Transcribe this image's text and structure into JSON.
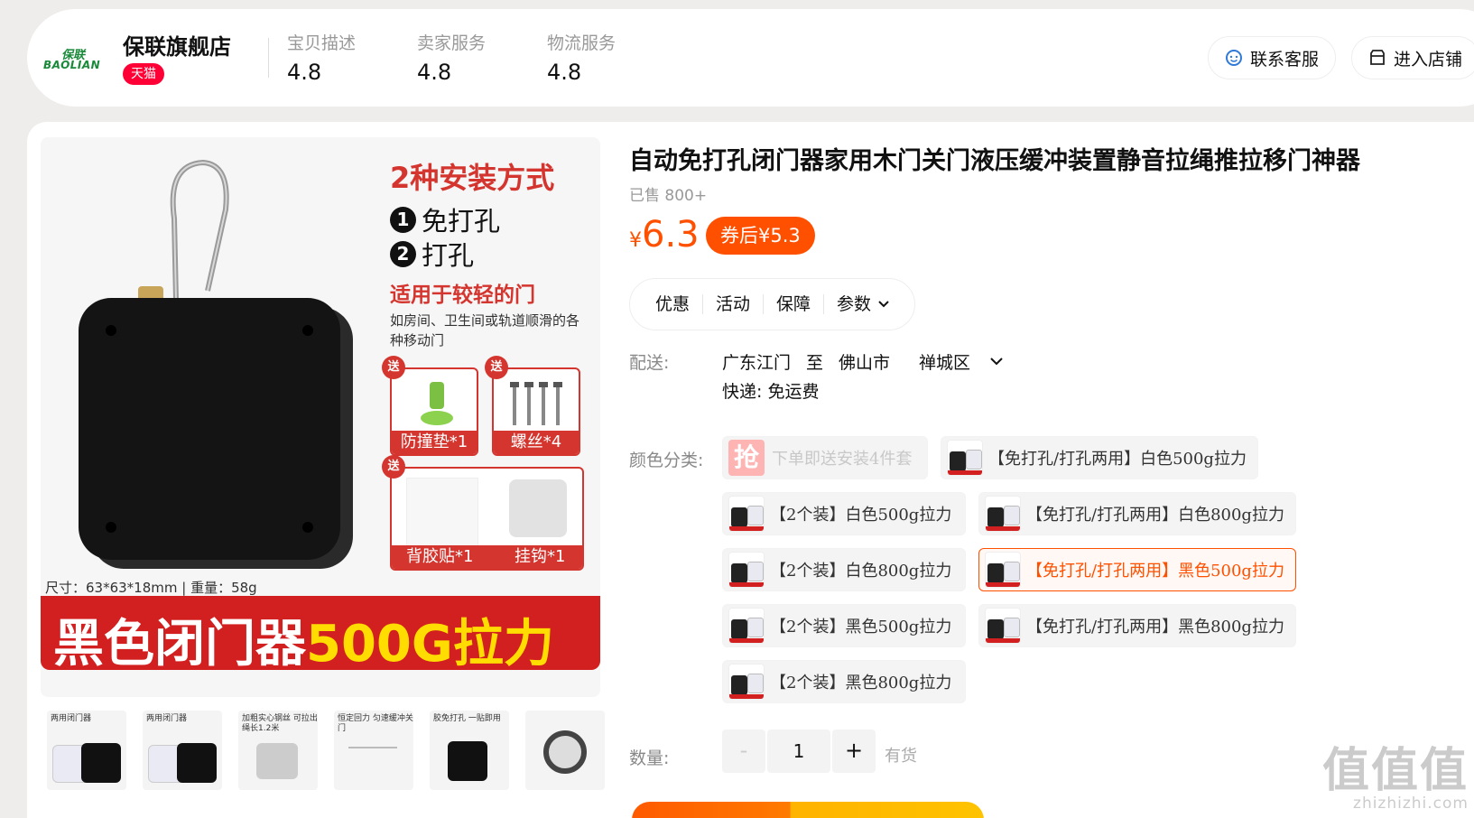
{
  "store": {
    "logo_cn": "保联",
    "logo_en": "BAOLIAN",
    "name": "保联旗舰店",
    "badge": "天猫",
    "ratings": [
      {
        "label": "宝贝描述",
        "value": "4.8"
      },
      {
        "label": "卖家服务",
        "value": "4.8"
      },
      {
        "label": "物流服务",
        "value": "4.8"
      }
    ],
    "contact_label": "联系客服",
    "enter_label": "进入店铺"
  },
  "image": {
    "install_title": "2种安装方式",
    "install_items": [
      {
        "num": "1",
        "text": "免打孔"
      },
      {
        "num": "2",
        "text": "打孔"
      }
    ],
    "suit_title": "适用于较轻的门",
    "suit_desc": "如房间、卫生间或轨道顺滑的各种移动门",
    "gift_tag": "送",
    "gifts": [
      "防撞垫*1",
      "螺丝*4",
      "背胶贴*1",
      "挂钩*1"
    ],
    "spec_size": "尺寸：63*63*18mm",
    "spec_weight": "重量：58g",
    "banner_white": "黑色闭门器",
    "banner_yellow": "500G拉力"
  },
  "thumbnails": [
    {
      "caption": "两用闭门器"
    },
    {
      "caption": "两用闭门器"
    },
    {
      "caption": "加粗实心钢丝 可拉出绳长1.2米"
    },
    {
      "caption": "恒定回力 匀速缓冲关门"
    },
    {
      "caption": "胶免打孔 一贴即用"
    },
    {
      "caption": ""
    }
  ],
  "product": {
    "title": "自动免打孔闭门器家用木门关门液压缓冲装置静音拉绳推拉移门神器",
    "sold": "已售 800+",
    "currency": "¥",
    "price": "6.3",
    "coupon_price": "券后¥5.3"
  },
  "tabs": [
    "优惠",
    "活动",
    "保障",
    "参数"
  ],
  "shipping": {
    "label": "配送:",
    "from": "广东江门",
    "to_word": "至",
    "city": "佛山市",
    "district": "禅城区",
    "express": "快递: 免运费"
  },
  "sku": {
    "label": "颜色分类:",
    "promo_icon": "抢",
    "items": [
      "下单即送安装4件套",
      "【免打孔/打孔两用】白色500g拉力",
      "【2个装】白色500g拉力",
      "【免打孔/打孔两用】白色800g拉力",
      "【2个装】白色800g拉力",
      "【免打孔/打孔两用】黑色500g拉力",
      "【2个装】黑色500g拉力",
      "【免打孔/打孔两用】黑色800g拉力",
      "【2个装】黑色800g拉力"
    ]
  },
  "quantity": {
    "label": "数量:",
    "minus": "-",
    "value": "1",
    "plus": "+",
    "stock": "有货"
  },
  "watermark": {
    "main": "值值值",
    "sub": "zhizhizhi.com"
  },
  "colors": {
    "accent": "#ff5000",
    "tmall": "#ff0036",
    "banner_red": "#d21f1f",
    "brand_green": "#1a8a3a"
  }
}
